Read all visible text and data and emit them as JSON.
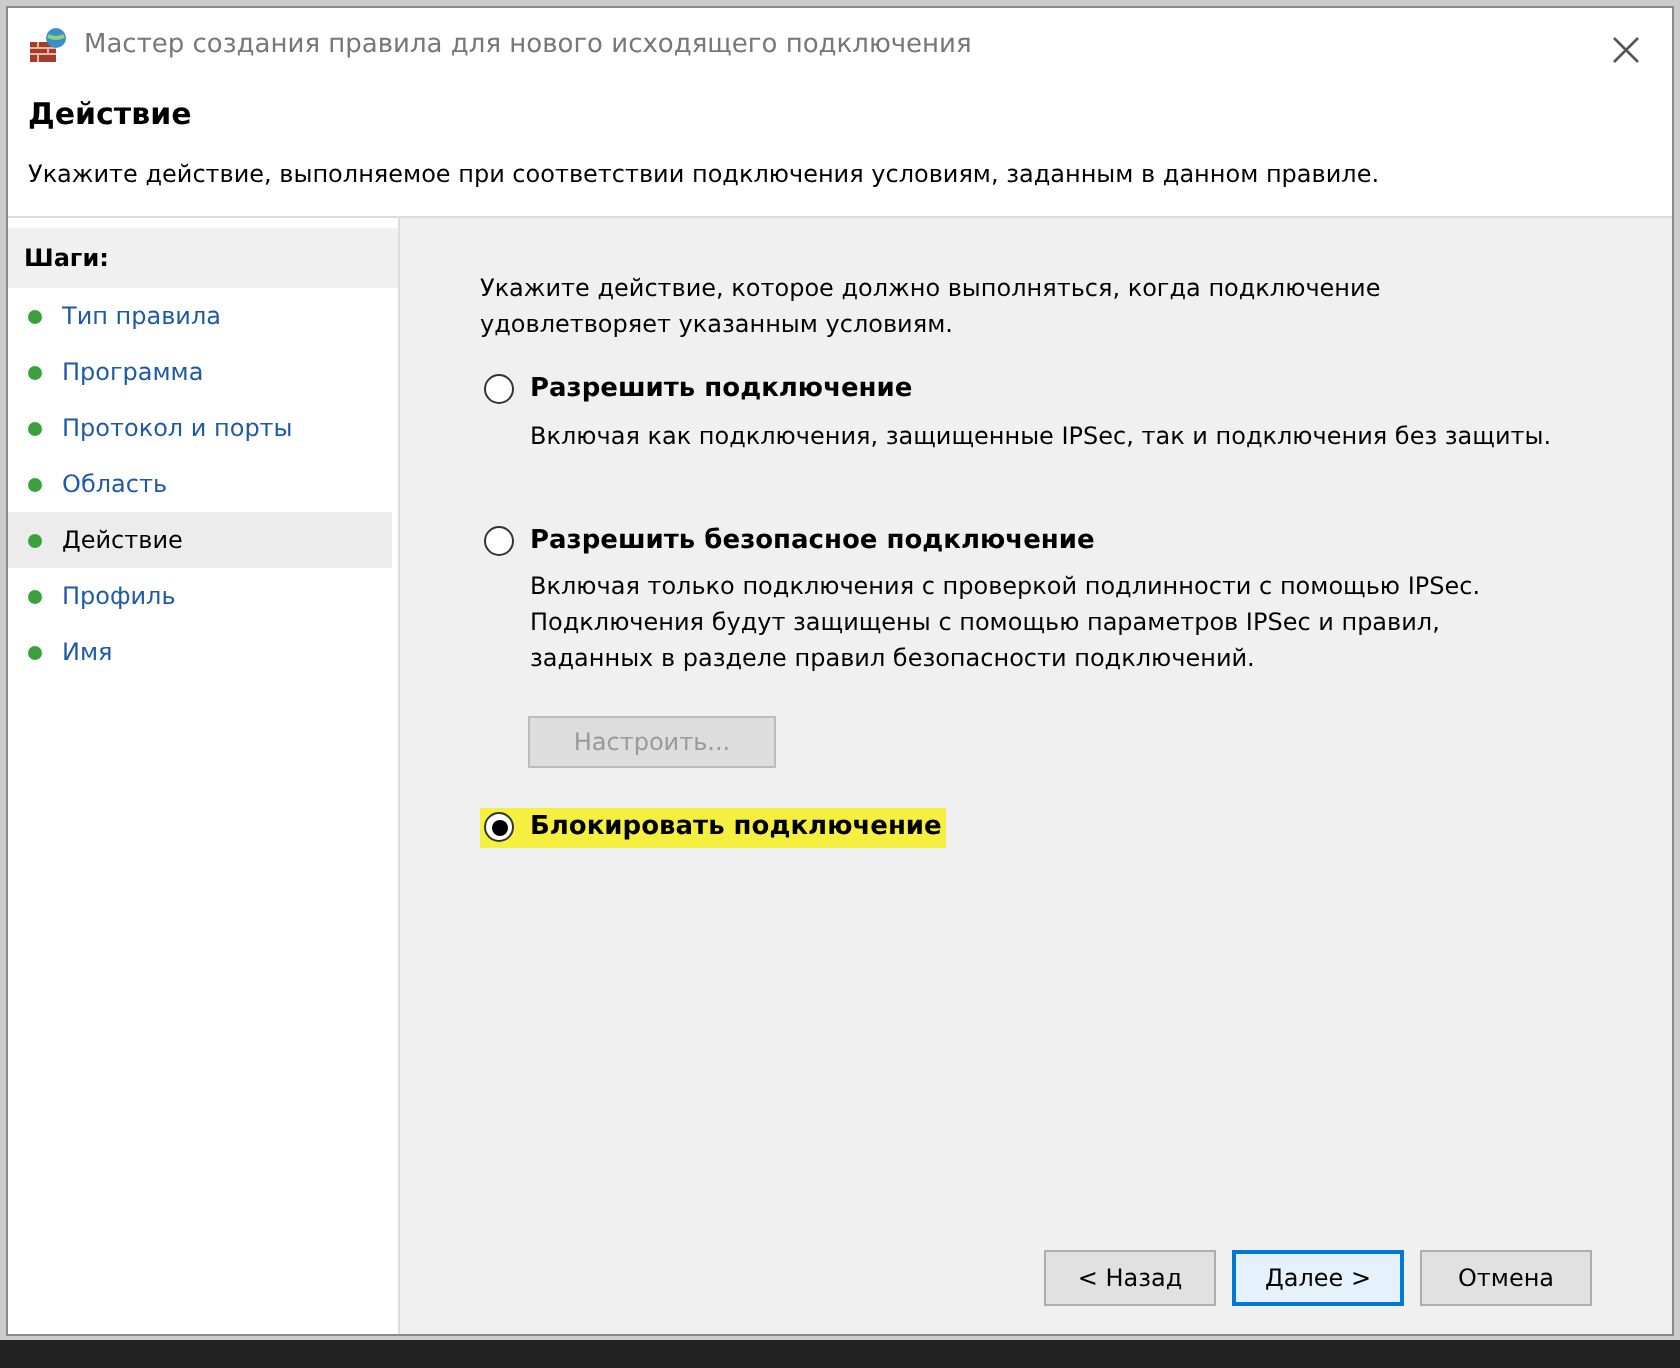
{
  "window": {
    "title": "Мастер создания правила для нового исходящего подключения"
  },
  "header": {
    "title": "Действие",
    "subtitle": "Укажите действие, выполняемое при соответствии подключения условиям, заданным в данном правиле."
  },
  "sidebar": {
    "heading": "Шаги:",
    "items": [
      {
        "label": "Тип правила",
        "selected": false
      },
      {
        "label": "Программа",
        "selected": false
      },
      {
        "label": "Протокол и порты",
        "selected": false
      },
      {
        "label": "Область",
        "selected": false
      },
      {
        "label": "Действие",
        "selected": true
      },
      {
        "label": "Профиль",
        "selected": false
      },
      {
        "label": "Имя",
        "selected": false
      }
    ]
  },
  "prompt": "Укажите действие, которое должно выполняться, когда подключение удовлетворяет указанным условиям.",
  "options": [
    {
      "label": "Разрешить подключение",
      "description": "Включая как подключения, защищенные IPSec, так и подключения без защиты.",
      "selected": false,
      "highlighted": false
    },
    {
      "label": "Разрешить безопасное подключение",
      "description": "Включая только подключения с проверкой подлинности с помощью IPSec. Подключения будут защищены с помощью параметров IPSec и правил, заданных в разделе правил безопасности подключений.",
      "selected": false,
      "highlighted": false,
      "button": {
        "label": "Настроить...",
        "disabled": true
      }
    },
    {
      "label": "Блокировать подключение",
      "selected": true,
      "highlighted": true
    }
  ],
  "buttons": [
    {
      "label": "< Назад",
      "default": false
    },
    {
      "label": "Далее >",
      "default": true
    },
    {
      "label": "Отмена",
      "default": false
    }
  ]
}
